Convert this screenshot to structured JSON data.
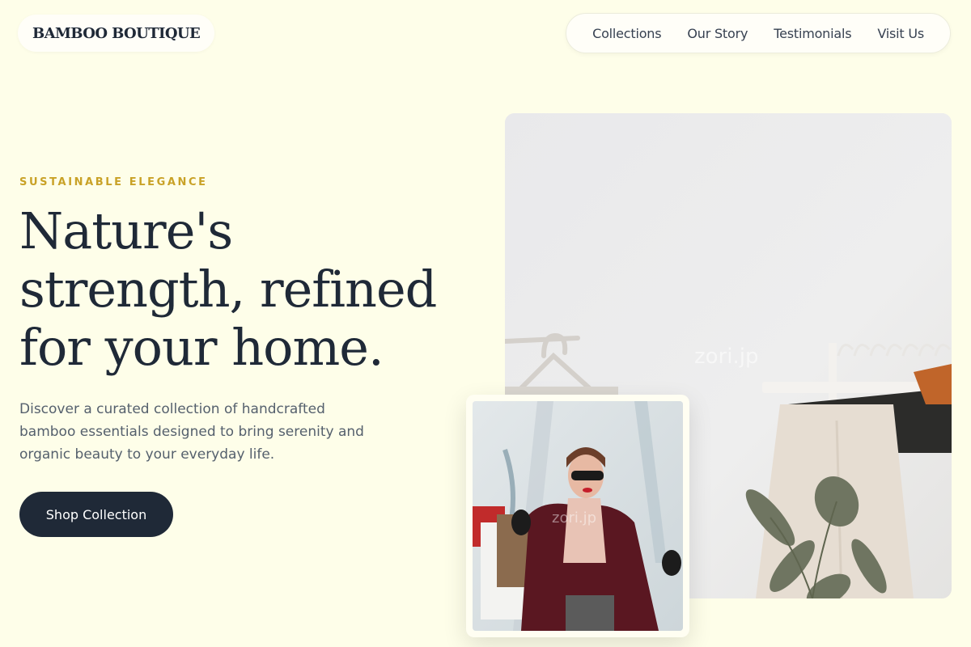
{
  "header": {
    "logo_text": "BAMBOO BOUTIQUE",
    "nav": [
      {
        "label": "Collections"
      },
      {
        "label": "Our Story"
      },
      {
        "label": "Testimonials"
      },
      {
        "label": "Visit Us"
      }
    ]
  },
  "hero": {
    "eyebrow": "SUSTAINABLE ELEGANCE",
    "headline": "Nature's strength, refined for your home.",
    "description": "Discover a curated collection of handcrafted bamboo essentials designed to bring serenity and organic beauty to your everyday life.",
    "cta_label": "Shop Collection"
  },
  "images": {
    "main_watermark": "zori.jp",
    "inset_watermark": "zori.jp"
  },
  "colors": {
    "background": "#fefee9",
    "accent": "#c9a227",
    "dark": "#1f2937"
  }
}
